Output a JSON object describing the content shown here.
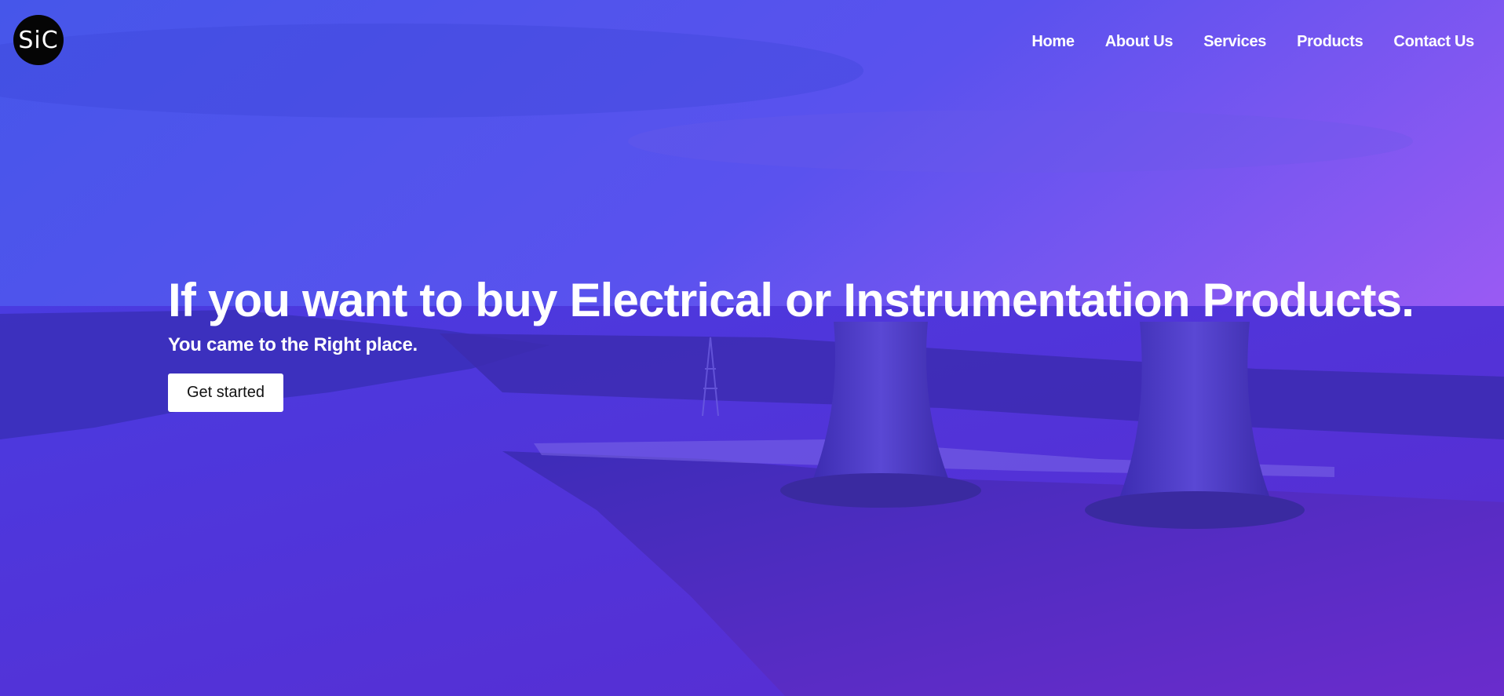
{
  "brand": {
    "logo_text": "SiC"
  },
  "nav": {
    "items": [
      {
        "label": "Home"
      },
      {
        "label": "About Us"
      },
      {
        "label": "Services"
      },
      {
        "label": "Products"
      },
      {
        "label": "Contact Us"
      }
    ]
  },
  "hero": {
    "headline": "If you want to buy Electrical or Instrumentation Products.",
    "subheadline": "You came to the Right place.",
    "cta_label": "Get started"
  },
  "colors": {
    "overlay_start": "#3f4fe6",
    "overlay_mid": "#5a2fd6",
    "overlay_end": "#9a4ef0",
    "logo_bg": "#050505",
    "button_bg": "#ffffff",
    "text": "#ffffff"
  }
}
